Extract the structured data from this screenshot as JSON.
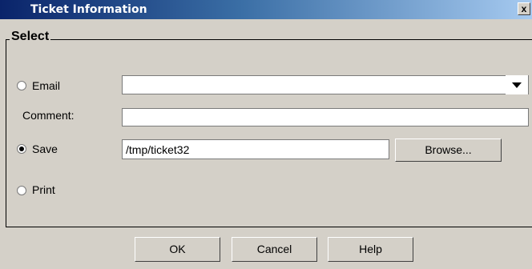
{
  "window": {
    "title": "Ticket Information",
    "close_glyph": "x"
  },
  "group": {
    "label": "Select"
  },
  "options": {
    "email": {
      "label": "Email",
      "selected": false,
      "value": ""
    },
    "comment": {
      "label": "Comment:",
      "value": ""
    },
    "save": {
      "label": "Save",
      "selected": true,
      "path": "/tmp/ticket32",
      "browse_label": "Browse..."
    },
    "print": {
      "label": "Print",
      "selected": false
    }
  },
  "buttons": {
    "ok": "OK",
    "cancel": "Cancel",
    "help": "Help"
  }
}
